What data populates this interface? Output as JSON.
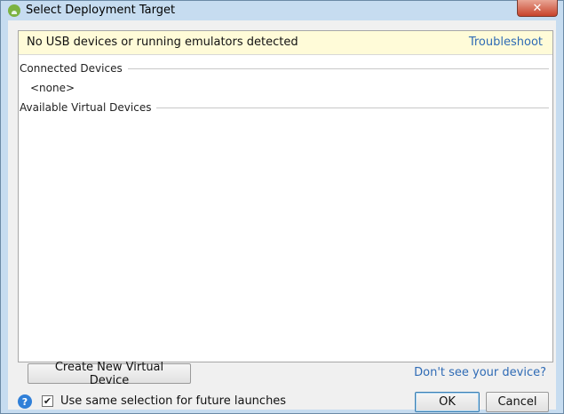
{
  "window": {
    "title": "Select Deployment Target",
    "close_glyph": "✕"
  },
  "notice": {
    "message": "No USB devices or running emulators detected",
    "link": "Troubleshoot"
  },
  "sections": {
    "connected": {
      "label": "Connected Devices",
      "items": [
        "<none>"
      ]
    },
    "virtual": {
      "label": "Available Virtual Devices",
      "items": []
    }
  },
  "actions": {
    "create_label": "Create New Virtual Device",
    "dont_see_link": "Don't see your device?"
  },
  "footer": {
    "help_glyph": "?",
    "checkbox_checked": true,
    "checkbox_glyph": "✔",
    "checkbox_label": "Use same selection for future launches",
    "ok_label": "OK",
    "cancel_label": "Cancel"
  },
  "colors": {
    "notice_bg": "#fffbd8",
    "link": "#2f6bb5",
    "title_bar": "#c6dcf0",
    "close_button": "#c7432b"
  },
  "icons": [
    "android-app-icon",
    "close-icon",
    "help-icon",
    "checkmark-icon"
  ]
}
